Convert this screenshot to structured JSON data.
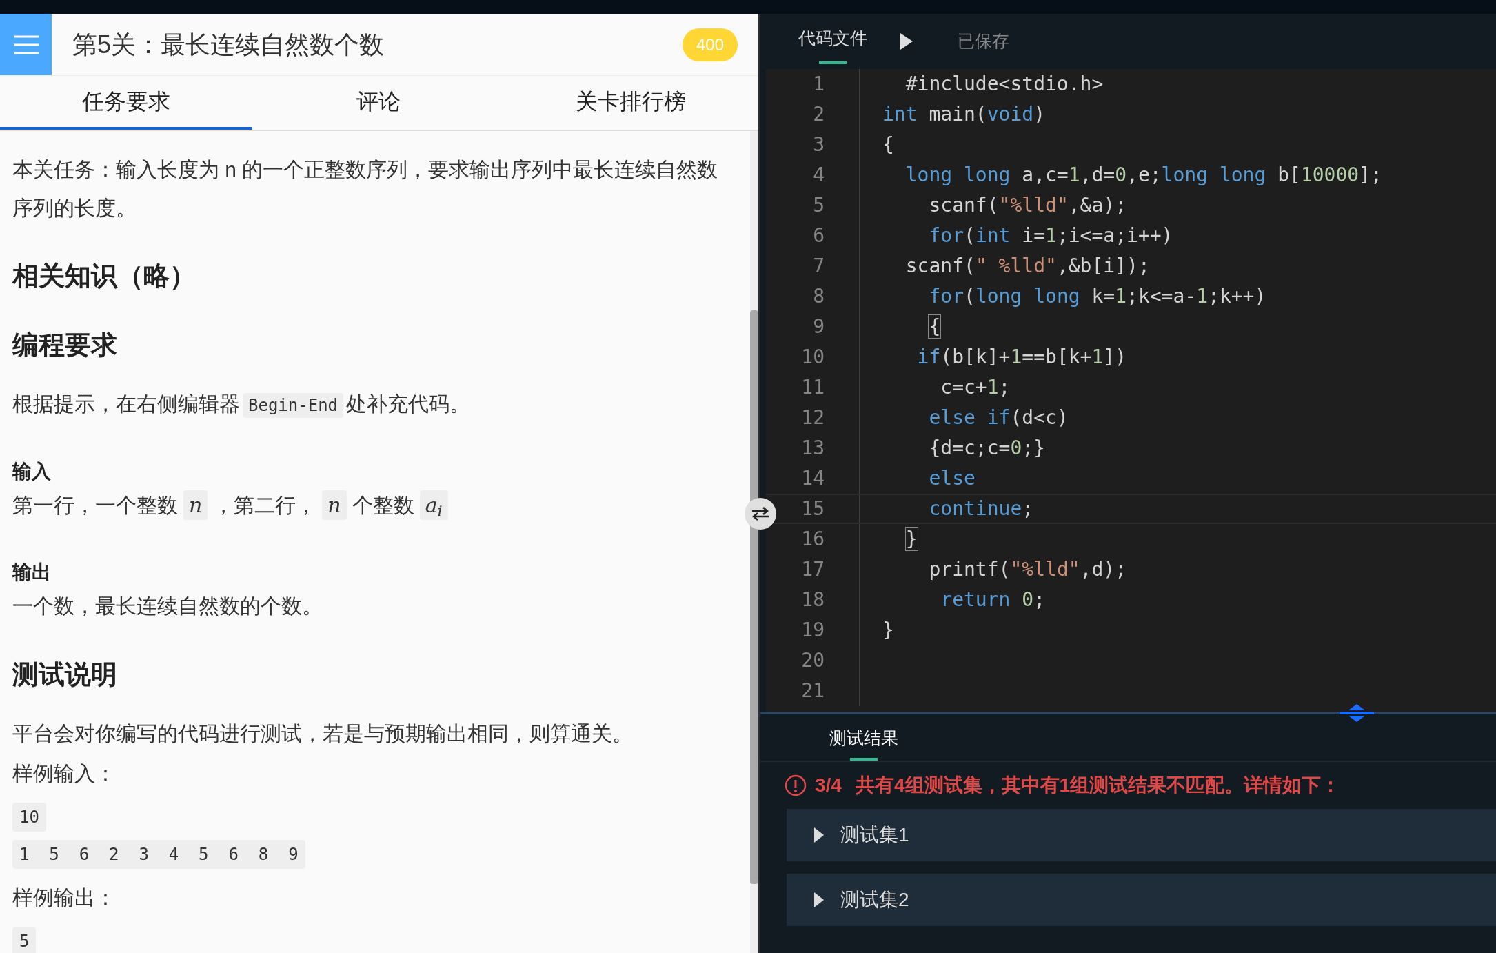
{
  "header": {
    "title": "第5关：最长连续自然数个数",
    "score": "400"
  },
  "tabs": [
    {
      "label": "任务要求",
      "selected": true
    },
    {
      "label": "评论",
      "selected": false
    },
    {
      "label": "关卡排行榜",
      "selected": false
    }
  ],
  "content": [
    {
      "kind": "paragraph",
      "segments": [
        {
          "kind": "text",
          "text": "本关任务：输入长度为 n 的一个正整数序列，要求输出序列中最长连续自然数序列的长度。"
        }
      ]
    },
    {
      "kind": "heading",
      "text": "相关知识（略）"
    },
    {
      "kind": "heading",
      "text": "编程要求"
    },
    {
      "kind": "paragraph",
      "segments": [
        {
          "kind": "text",
          "text": "根据提示，在右侧编辑器"
        },
        {
          "kind": "code",
          "text": "Begin-End"
        },
        {
          "kind": "text",
          "text": "处补充代码。"
        }
      ]
    },
    {
      "kind": "subheading",
      "text": "输入"
    },
    {
      "kind": "line",
      "segments": [
        {
          "kind": "text",
          "text": "第一行，一个整数"
        },
        {
          "kind": "math",
          "text": "n"
        },
        {
          "kind": "text",
          "text": "，第二行，"
        },
        {
          "kind": "math",
          "text": "n"
        },
        {
          "kind": "text",
          "text": "个整数"
        },
        {
          "kind": "math",
          "text": "a$_{i}$"
        }
      ]
    },
    {
      "kind": "subheading",
      "text": "输出"
    },
    {
      "kind": "line",
      "segments": [
        {
          "kind": "text",
          "text": "一个数，最长连续自然数的个数。"
        }
      ]
    },
    {
      "kind": "heading",
      "text": "测试说明"
    },
    {
      "kind": "paragraph",
      "segments": [
        {
          "kind": "text",
          "text": "平台会对你编写的代码进行测试，若是与预期输出相同，则算通关。"
        }
      ]
    },
    {
      "kind": "label",
      "text": "样例输入："
    },
    {
      "kind": "sample",
      "text": "10"
    },
    {
      "kind": "sample",
      "text": "1 5 6 2 3 4 5 6 8 9"
    },
    {
      "kind": "label",
      "text": "样例输出："
    },
    {
      "kind": "sample",
      "text": "5"
    }
  ],
  "editor": {
    "file_tab": "代码文件",
    "status": "已保存",
    "lines": [
      {
        "number": "1",
        "current": false,
        "tokens": [
          {
            "kind": "plain",
            "text": "  #include<stdio.h>"
          }
        ]
      },
      {
        "number": "2",
        "current": false,
        "tokens": [
          {
            "kind": "keyword",
            "text": "int"
          },
          {
            "kind": "plain",
            "text": " main("
          },
          {
            "kind": "keyword",
            "text": "void"
          },
          {
            "kind": "plain",
            "text": ")"
          }
        ]
      },
      {
        "number": "3",
        "current": false,
        "tokens": [
          {
            "kind": "plain",
            "text": "{"
          }
        ]
      },
      {
        "number": "4",
        "current": false,
        "tokens": [
          {
            "kind": "keyword",
            "text": "  long long"
          },
          {
            "kind": "plain",
            "text": " a,c="
          },
          {
            "kind": "number",
            "text": "1"
          },
          {
            "kind": "plain",
            "text": ",d="
          },
          {
            "kind": "number",
            "text": "0"
          },
          {
            "kind": "plain",
            "text": ",e;"
          },
          {
            "kind": "keyword",
            "text": "long long"
          },
          {
            "kind": "plain",
            "text": " b["
          },
          {
            "kind": "number",
            "text": "10000"
          },
          {
            "kind": "plain",
            "text": "];"
          }
        ]
      },
      {
        "number": "5",
        "current": false,
        "tokens": [
          {
            "kind": "plain",
            "text": "    scanf("
          },
          {
            "kind": "string",
            "text": "\"%lld\""
          },
          {
            "kind": "plain",
            "text": ",&a);"
          }
        ]
      },
      {
        "number": "6",
        "current": false,
        "tokens": [
          {
            "kind": "keyword",
            "text": "    for"
          },
          {
            "kind": "plain",
            "text": "("
          },
          {
            "kind": "keyword",
            "text": "int"
          },
          {
            "kind": "plain",
            "text": " i="
          },
          {
            "kind": "number",
            "text": "1"
          },
          {
            "kind": "plain",
            "text": ";i<=a;i++)"
          }
        ]
      },
      {
        "number": "7",
        "current": false,
        "tokens": [
          {
            "kind": "plain",
            "text": "  scanf("
          },
          {
            "kind": "string",
            "text": "\" %lld\""
          },
          {
            "kind": "plain",
            "text": ",&b[i]);"
          }
        ]
      },
      {
        "number": "8",
        "current": false,
        "tokens": [
          {
            "kind": "keyword",
            "text": "    for"
          },
          {
            "kind": "plain",
            "text": "("
          },
          {
            "kind": "keyword",
            "text": "long long"
          },
          {
            "kind": "plain",
            "text": " k="
          },
          {
            "kind": "number",
            "text": "1"
          },
          {
            "kind": "plain",
            "text": ";k<=a-"
          },
          {
            "kind": "number",
            "text": "1"
          },
          {
            "kind": "plain",
            "text": ";k++)"
          }
        ]
      },
      {
        "number": "9",
        "current": false,
        "tokens": [
          {
            "kind": "bracket",
            "text": "    {"
          }
        ]
      },
      {
        "number": "10",
        "current": false,
        "tokens": [
          {
            "kind": "keyword",
            "text": "   if"
          },
          {
            "kind": "plain",
            "text": "(b[k]+"
          },
          {
            "kind": "number",
            "text": "1"
          },
          {
            "kind": "plain",
            "text": "==b[k+"
          },
          {
            "kind": "number",
            "text": "1"
          },
          {
            "kind": "plain",
            "text": "])"
          }
        ]
      },
      {
        "number": "11",
        "current": false,
        "tokens": [
          {
            "kind": "plain",
            "text": "     c=c+"
          },
          {
            "kind": "number",
            "text": "1"
          },
          {
            "kind": "plain",
            "text": ";"
          }
        ]
      },
      {
        "number": "12",
        "current": false,
        "tokens": [
          {
            "kind": "keyword",
            "text": "    else if"
          },
          {
            "kind": "plain",
            "text": "(d<c)"
          }
        ]
      },
      {
        "number": "13",
        "current": false,
        "tokens": [
          {
            "kind": "plain",
            "text": "    {d=c;c="
          },
          {
            "kind": "number",
            "text": "0"
          },
          {
            "kind": "plain",
            "text": ";}"
          }
        ]
      },
      {
        "number": "14",
        "current": false,
        "tokens": [
          {
            "kind": "keyword",
            "text": "    else"
          }
        ]
      },
      {
        "number": "15",
        "current": true,
        "tokens": [
          {
            "kind": "keyword",
            "text": "    continue"
          },
          {
            "kind": "plain",
            "text": ";"
          }
        ]
      },
      {
        "number": "16",
        "current": false,
        "tokens": [
          {
            "kind": "bracket",
            "text": "  }"
          }
        ]
      },
      {
        "number": "17",
        "current": false,
        "tokens": [
          {
            "kind": "plain",
            "text": "    printf("
          },
          {
            "kind": "string",
            "text": "\"%lld\""
          },
          {
            "kind": "plain",
            "text": ",d);"
          }
        ]
      },
      {
        "number": "18",
        "current": false,
        "tokens": [
          {
            "kind": "keyword",
            "text": "     return"
          },
          {
            "kind": "number",
            "text": " 0"
          },
          {
            "kind": "plain",
            "text": ";"
          }
        ]
      },
      {
        "number": "19",
        "current": false,
        "tokens": [
          {
            "kind": "plain",
            "text": "}"
          }
        ]
      },
      {
        "number": "20",
        "current": false
      },
      {
        "number": "21",
        "current": false
      }
    ]
  },
  "results": {
    "tab": "测试结果",
    "score": "3/4",
    "message": "共有4组测试集，其中有1组测试结果不匹配。详情如下：",
    "test_sets": [
      {
        "label": "测试集1",
        "expanded": false
      },
      {
        "label": "测试集2",
        "expanded": false
      }
    ]
  }
}
